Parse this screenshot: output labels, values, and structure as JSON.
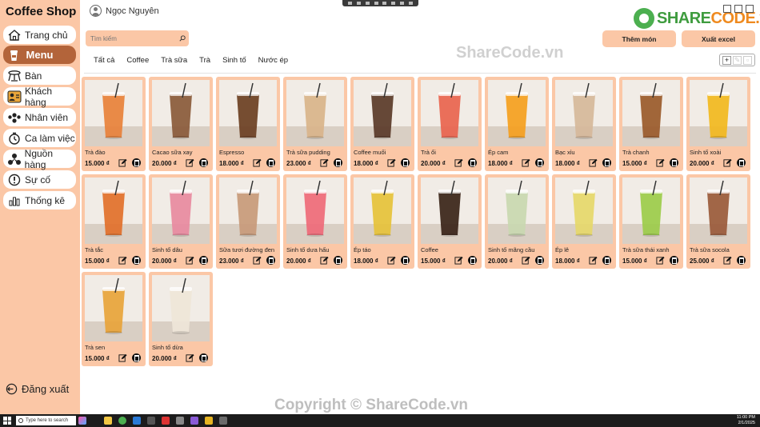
{
  "app": {
    "title": "Coffee Shop"
  },
  "sidebar": {
    "items": [
      {
        "label": "Trang chủ",
        "icon": "home-icon"
      },
      {
        "label": "Menu",
        "icon": "cup-icon",
        "active": true
      },
      {
        "label": "Bàn",
        "icon": "table-icon"
      },
      {
        "label": "Khách hàng",
        "icon": "customer-icon"
      },
      {
        "label": "Nhân viên",
        "icon": "staff-icon"
      },
      {
        "label": "Ca làm việc",
        "icon": "clock-icon"
      },
      {
        "label": "Nguồn hàng",
        "icon": "supply-icon"
      },
      {
        "label": "Sự cố",
        "icon": "alert-icon"
      },
      {
        "label": "Thống kê",
        "icon": "chart-icon"
      }
    ],
    "logout_label": "Đăng xuất"
  },
  "header": {
    "user_name": "Ngọc Nguyên",
    "search_placeholder": "Tìm kiếm",
    "add_label": "Thêm món",
    "export_label": "Xuất excel",
    "logo_left": "SHARE",
    "logo_right": "CODE.vn"
  },
  "categories": [
    "Tất cả",
    "Coffee",
    "Trà sữa",
    "Trà",
    "Sinh tố",
    "Nước ép"
  ],
  "products": [
    {
      "name": "Trà đào",
      "price": "15.000 ₫",
      "color": "#e8813a"
    },
    {
      "name": "Cacao sữa xay",
      "price": "20.000 ₫",
      "color": "#8a5a3a"
    },
    {
      "name": "Espresso",
      "price": "18.000 ₫",
      "color": "#6b3f22"
    },
    {
      "name": "Trà sữa pudding",
      "price": "23.000 ₫",
      "color": "#d9b48a"
    },
    {
      "name": "Coffee muối",
      "price": "18.000 ₫",
      "color": "#5a3a28"
    },
    {
      "name": "Trà ổi",
      "price": "20.000 ₫",
      "color": "#e9644e"
    },
    {
      "name": "Ép cam",
      "price": "18.000 ₫",
      "color": "#f5a01e"
    },
    {
      "name": "Bạc xỉu",
      "price": "18.000 ₫",
      "color": "#d6b89a"
    },
    {
      "name": "Trà chanh",
      "price": "15.000 ₫",
      "color": "#9a5a2a"
    },
    {
      "name": "Sinh tố xoài",
      "price": "20.000 ₫",
      "color": "#f2b81e"
    },
    {
      "name": "Trà tắc",
      "price": "15.000 ₫",
      "color": "#e2702a"
    },
    {
      "name": "Sinh tố dâu",
      "price": "20.000 ₫",
      "color": "#e88aa0"
    },
    {
      "name": "Sữa tươi đường đen",
      "price": "23.000 ₫",
      "color": "#c89a7a"
    },
    {
      "name": "Sinh tố dưa hấu",
      "price": "20.000 ₫",
      "color": "#ef6a78"
    },
    {
      "name": "Ép táo",
      "price": "18.000 ₫",
      "color": "#e6c23a"
    },
    {
      "name": "Coffee",
      "price": "15.000 ₫",
      "color": "#3a2418"
    },
    {
      "name": "Sinh tố mãng cầu",
      "price": "20.000 ₫",
      "color": "#c9d8b0"
    },
    {
      "name": "Ép lê",
      "price": "18.000 ₫",
      "color": "#e6d86a"
    },
    {
      "name": "Trà sữa thái xanh",
      "price": "15.000 ₫",
      "color": "#9ccc4a"
    },
    {
      "name": "Trà sữa socola",
      "price": "25.000 ₫",
      "color": "#9a5a3a"
    },
    {
      "name": "Trà sen",
      "price": "15.000 ₫",
      "color": "#e8a43a"
    },
    {
      "name": "Sinh tố dừa",
      "price": "20.000 ₫",
      "color": "#efe6d8"
    }
  ],
  "watermark": "ShareCode.vn",
  "copyright": "Copyright © ShareCode.vn",
  "taskbar": {
    "search_placeholder": "Type here to search",
    "time": "11:00 PM",
    "date": "2/1/2025"
  }
}
